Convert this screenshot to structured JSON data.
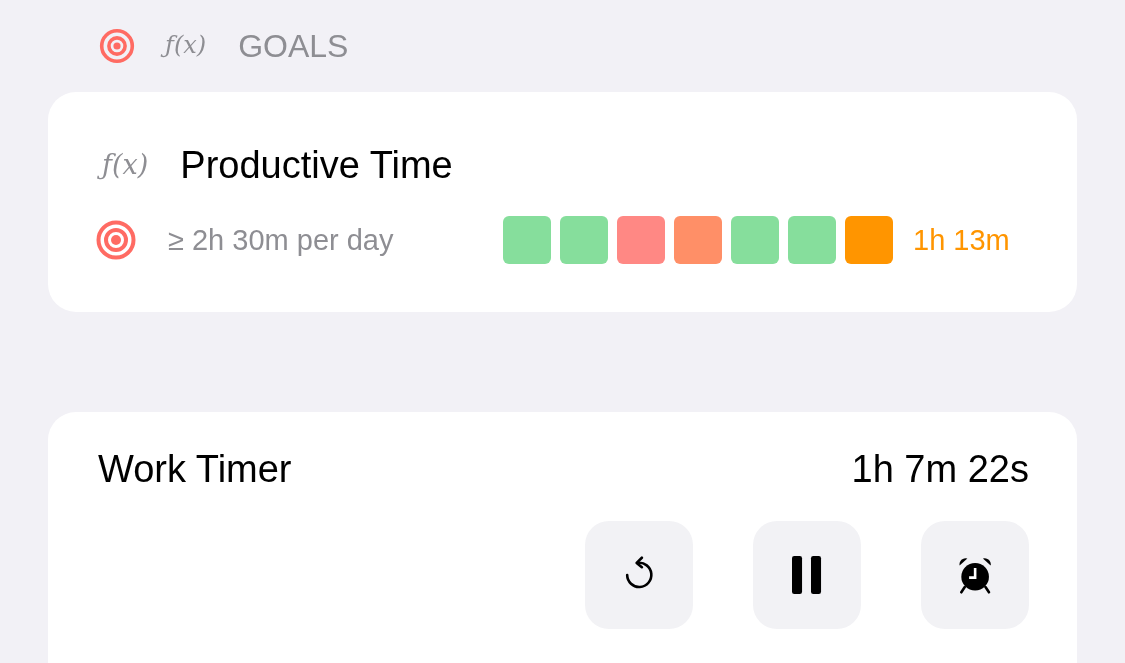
{
  "section": {
    "formula_mark": "ƒ(x)",
    "title": "GOALS"
  },
  "goal": {
    "formula_mark": "ƒ(x)",
    "name": "Productive Time",
    "target": "≥ 2h 30m per day",
    "days": [
      {
        "color": "#86de9c"
      },
      {
        "color": "#86de9c"
      },
      {
        "color": "#ff8884"
      },
      {
        "color": "#ff8f67"
      },
      {
        "color": "#86de9c"
      },
      {
        "color": "#86de9c"
      },
      {
        "color": "#ff9500"
      }
    ],
    "today": "1h 13m"
  },
  "timer": {
    "title": "Work Timer",
    "elapsed": "1h 7m 22s",
    "buttons": [
      {
        "kind": "reset"
      },
      {
        "kind": "pause"
      },
      {
        "kind": "alarm"
      }
    ]
  }
}
